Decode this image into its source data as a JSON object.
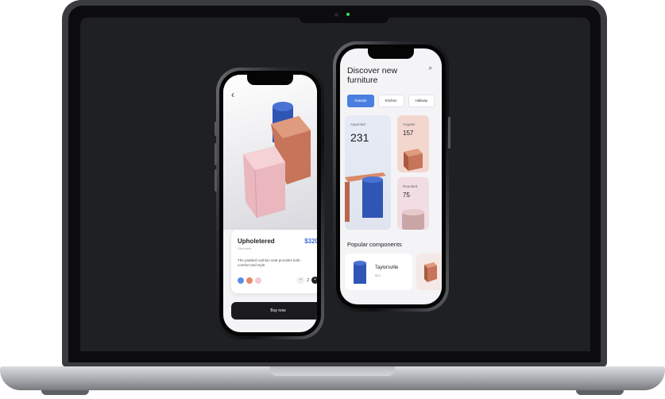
{
  "detail_screen": {
    "product_name": "Upholetered",
    "product_subtitle": "Ottomans",
    "price": "$320",
    "description": "The padded cushion seat provides both comfort and style.",
    "quantity": "2",
    "qty_minus": "−",
    "qty_plus": "+",
    "buy_label": "Buy now",
    "back_glyph": "‹",
    "swatch_colors": [
      "#5b8be6",
      "#e8866a",
      "#f3c9cf"
    ]
  },
  "discover_screen": {
    "title": "Discover new furniture",
    "search_glyph": "⌕",
    "tabs": [
      "Outside",
      "Kitchen",
      "Hallway"
    ],
    "tiles": [
      {
        "label": "Aspected",
        "count": "231"
      },
      {
        "label": "Angular",
        "count": "157"
      },
      {
        "label": "Rounded",
        "count": "75"
      }
    ],
    "popular_heading": "Popular components",
    "popular_item_name": "Taylorsville",
    "popular_item_price": "$26"
  },
  "colors": {
    "accent_blue": "#4a7fe0",
    "terracotta": "#c97a5c",
    "pink": "#eec0c6"
  }
}
